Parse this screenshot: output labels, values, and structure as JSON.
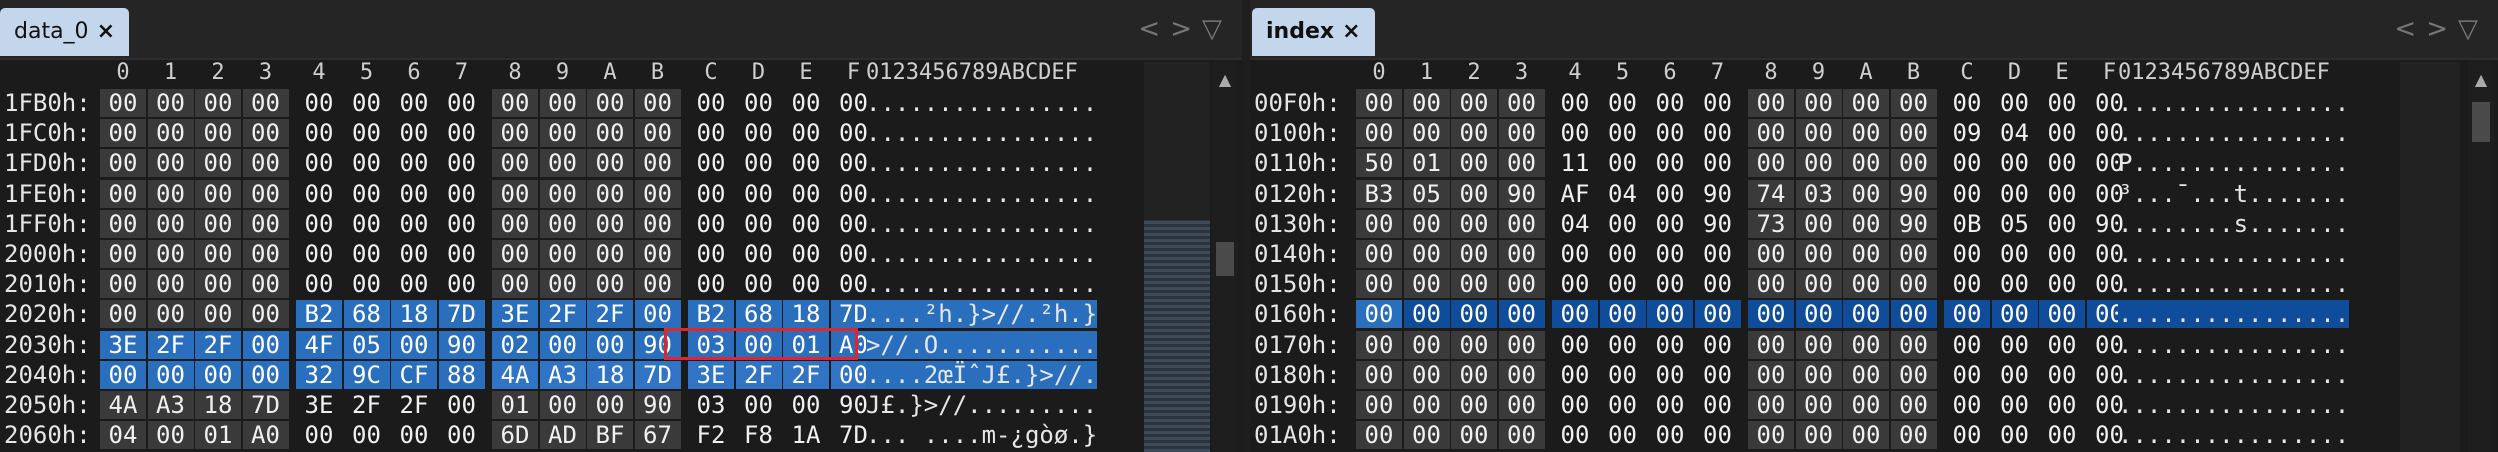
{
  "left": {
    "tab_label": "data_0",
    "close_icon": "×",
    "nav_back": "<",
    "nav_fwd": ">",
    "menu_icon": "▽",
    "col_headers": [
      "0",
      "1",
      "2",
      "3",
      "4",
      "5",
      "6",
      "7",
      "8",
      "9",
      "A",
      "B",
      "C",
      "D",
      "E",
      "F"
    ],
    "ascii_header": "0123456789ABCDEF",
    "rows": [
      {
        "addr": "1FB0h:",
        "bytes": [
          "00",
          "00",
          "00",
          "00",
          "00",
          "00",
          "00",
          "00",
          "00",
          "00",
          "00",
          "00",
          "00",
          "00",
          "00",
          "00"
        ],
        "ascii": "................"
      },
      {
        "addr": "1FC0h:",
        "bytes": [
          "00",
          "00",
          "00",
          "00",
          "00",
          "00",
          "00",
          "00",
          "00",
          "00",
          "00",
          "00",
          "00",
          "00",
          "00",
          "00"
        ],
        "ascii": "................"
      },
      {
        "addr": "1FD0h:",
        "bytes": [
          "00",
          "00",
          "00",
          "00",
          "00",
          "00",
          "00",
          "00",
          "00",
          "00",
          "00",
          "00",
          "00",
          "00",
          "00",
          "00"
        ],
        "ascii": "................"
      },
      {
        "addr": "1FE0h:",
        "bytes": [
          "00",
          "00",
          "00",
          "00",
          "00",
          "00",
          "00",
          "00",
          "00",
          "00",
          "00",
          "00",
          "00",
          "00",
          "00",
          "00"
        ],
        "ascii": "................"
      },
      {
        "addr": "1FF0h:",
        "bytes": [
          "00",
          "00",
          "00",
          "00",
          "00",
          "00",
          "00",
          "00",
          "00",
          "00",
          "00",
          "00",
          "00",
          "00",
          "00",
          "00"
        ],
        "ascii": "................"
      },
      {
        "addr": "2000h:",
        "bytes": [
          "00",
          "00",
          "00",
          "00",
          "00",
          "00",
          "00",
          "00",
          "00",
          "00",
          "00",
          "00",
          "00",
          "00",
          "00",
          "00"
        ],
        "ascii": "................"
      },
      {
        "addr": "2010h:",
        "bytes": [
          "00",
          "00",
          "00",
          "00",
          "00",
          "00",
          "00",
          "00",
          "00",
          "00",
          "00",
          "00",
          "00",
          "00",
          "00",
          "00"
        ],
        "ascii": "................"
      },
      {
        "addr": "2020h:",
        "bytes": [
          "00",
          "00",
          "00",
          "00",
          "B2",
          "68",
          "18",
          "7D",
          "3E",
          "2F",
          "2F",
          "00",
          "B2",
          "68",
          "18",
          "7D"
        ],
        "ascii": "....²h.}>//.²h.}"
      },
      {
        "addr": "2030h:",
        "bytes": [
          "3E",
          "2F",
          "2F",
          "00",
          "4F",
          "05",
          "00",
          "90",
          "02",
          "00",
          "00",
          "90",
          "03",
          "00",
          "01",
          "A0"
        ],
        "ascii": ">//.O..........."
      },
      {
        "addr": "2040h:",
        "bytes": [
          "00",
          "00",
          "00",
          "00",
          "32",
          "9C",
          "CF",
          "88",
          "4A",
          "A3",
          "18",
          "7D",
          "3E",
          "2F",
          "2F",
          "00"
        ],
        "ascii": "....2œÏˆJ£.}>//."
      },
      {
        "addr": "2050h:",
        "bytes": [
          "4A",
          "A3",
          "18",
          "7D",
          "3E",
          "2F",
          "2F",
          "00",
          "01",
          "00",
          "00",
          "90",
          "03",
          "00",
          "00",
          "90"
        ],
        "ascii": "J£.}>//........."
      },
      {
        "addr": "2060h:",
        "bytes": [
          "04",
          "00",
          "01",
          "A0",
          "00",
          "00",
          "00",
          "00",
          "6D",
          "AD",
          "BF",
          "67",
          "F2",
          "F8",
          "1A",
          "7D"
        ],
        "ascii": "... ....m-¿gòø.}"
      }
    ]
  },
  "right": {
    "tab_label": "index",
    "close_icon": "×",
    "nav_back": "<",
    "nav_fwd": ">",
    "menu_icon": "▽",
    "col_headers": [
      "0",
      "1",
      "2",
      "3",
      "4",
      "5",
      "6",
      "7",
      "8",
      "9",
      "A",
      "B",
      "C",
      "D",
      "E",
      "F"
    ],
    "ascii_header": "0123456789ABCDEF",
    "rows": [
      {
        "addr": "00F0h:",
        "bytes": [
          "00",
          "00",
          "00",
          "00",
          "00",
          "00",
          "00",
          "00",
          "00",
          "00",
          "00",
          "00",
          "00",
          "00",
          "00",
          "00"
        ],
        "ascii": "................"
      },
      {
        "addr": "0100h:",
        "bytes": [
          "00",
          "00",
          "00",
          "00",
          "00",
          "00",
          "00",
          "00",
          "00",
          "00",
          "00",
          "00",
          "09",
          "04",
          "00",
          "00"
        ],
        "ascii": "................"
      },
      {
        "addr": "0110h:",
        "bytes": [
          "50",
          "01",
          "00",
          "00",
          "11",
          "00",
          "00",
          "00",
          "00",
          "00",
          "00",
          "00",
          "00",
          "00",
          "00",
          "00"
        ],
        "ascii": "P..............."
      },
      {
        "addr": "0120h:",
        "bytes": [
          "B3",
          "05",
          "00",
          "90",
          "AF",
          "04",
          "00",
          "90",
          "74",
          "03",
          "00",
          "90",
          "00",
          "00",
          "00",
          "00"
        ],
        "ascii": "³...¯...t......."
      },
      {
        "addr": "0130h:",
        "bytes": [
          "00",
          "00",
          "00",
          "00",
          "04",
          "00",
          "00",
          "90",
          "73",
          "00",
          "00",
          "90",
          "0B",
          "05",
          "00",
          "90"
        ],
        "ascii": "........s......."
      },
      {
        "addr": "0140h:",
        "bytes": [
          "00",
          "00",
          "00",
          "00",
          "00",
          "00",
          "00",
          "00",
          "00",
          "00",
          "00",
          "00",
          "00",
          "00",
          "00",
          "00"
        ],
        "ascii": "................"
      },
      {
        "addr": "0150h:",
        "bytes": [
          "00",
          "00",
          "00",
          "00",
          "00",
          "00",
          "00",
          "00",
          "00",
          "00",
          "00",
          "00",
          "00",
          "00",
          "00",
          "00"
        ],
        "ascii": "................"
      },
      {
        "addr": "0160h:",
        "bytes": [
          "00",
          "00",
          "00",
          "00",
          "00",
          "00",
          "00",
          "00",
          "00",
          "00",
          "00",
          "00",
          "00",
          "00",
          "00",
          "00"
        ],
        "ascii": "................"
      },
      {
        "addr": "0170h:",
        "bytes": [
          "00",
          "00",
          "00",
          "00",
          "00",
          "00",
          "00",
          "00",
          "00",
          "00",
          "00",
          "00",
          "00",
          "00",
          "00",
          "00"
        ],
        "ascii": "................"
      },
      {
        "addr": "0180h:",
        "bytes": [
          "00",
          "00",
          "00",
          "00",
          "00",
          "00",
          "00",
          "00",
          "00",
          "00",
          "00",
          "00",
          "00",
          "00",
          "00",
          "00"
        ],
        "ascii": "................"
      },
      {
        "addr": "0190h:",
        "bytes": [
          "00",
          "00",
          "00",
          "00",
          "00",
          "00",
          "00",
          "00",
          "00",
          "00",
          "00",
          "00",
          "00",
          "00",
          "00",
          "00"
        ],
        "ascii": "................"
      },
      {
        "addr": "01A0h:",
        "bytes": [
          "00",
          "00",
          "00",
          "00",
          "00",
          "00",
          "00",
          "00",
          "00",
          "00",
          "00",
          "00",
          "00",
          "00",
          "00",
          "00"
        ],
        "ascii": "................"
      }
    ]
  },
  "colors": {
    "selection": "#2a6fbd",
    "cursor": "#0f4d9a",
    "highlight_box": "#e0262b",
    "tab_bg": "#c4d6ec"
  }
}
